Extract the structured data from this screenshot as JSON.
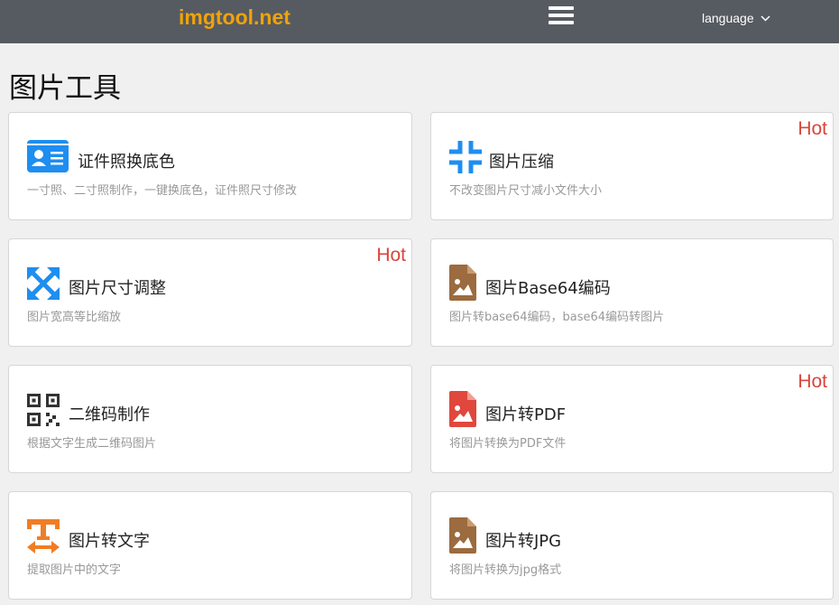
{
  "navbar": {
    "brand": "imgtool.net",
    "menu_icon": "hamburger-menu-icon",
    "language_label": "language",
    "language_icon": "chevron-down-icon"
  },
  "page": {
    "title": "图片工具"
  },
  "colors": {
    "navbar_bg": "#565b62",
    "brand": "#f0a30a",
    "hot": "#d9453a",
    "blue_icon": "#1e8ef0",
    "brown_icon": "#9c6b3f",
    "red_icon": "#e0473d",
    "orange_icon": "#f07d24"
  },
  "tools": [
    {
      "title": "证件照换底色",
      "desc": "一寸照、二寸照制作，一键换底色，证件照尺寸修改",
      "icon": "id-card-icon",
      "hot": ""
    },
    {
      "title": "图片压缩",
      "desc": "不改变图片尺寸减小文件大小",
      "icon": "compress-icon",
      "hot": "Hot"
    },
    {
      "title": "图片尺寸调整",
      "desc": "图片宽高等比缩放",
      "icon": "expand-arrows-icon",
      "hot": "Hot"
    },
    {
      "title": "图片Base64编码",
      "desc": "图片转base64编码，base64编码转图片",
      "icon": "image-file-icon",
      "hot": ""
    },
    {
      "title": "二维码制作",
      "desc": "根据文字生成二维码图片",
      "icon": "qr-code-icon",
      "hot": ""
    },
    {
      "title": "图片转PDF",
      "desc": "将图片转换为PDF文件",
      "icon": "pdf-image-file-icon",
      "hot": "Hot"
    },
    {
      "title": "图片转文字",
      "desc": "提取图片中的文字",
      "icon": "text-width-icon",
      "hot": ""
    },
    {
      "title": "图片转JPG",
      "desc": "将图片转换为jpg格式",
      "icon": "image-file-icon",
      "hot": ""
    }
  ]
}
